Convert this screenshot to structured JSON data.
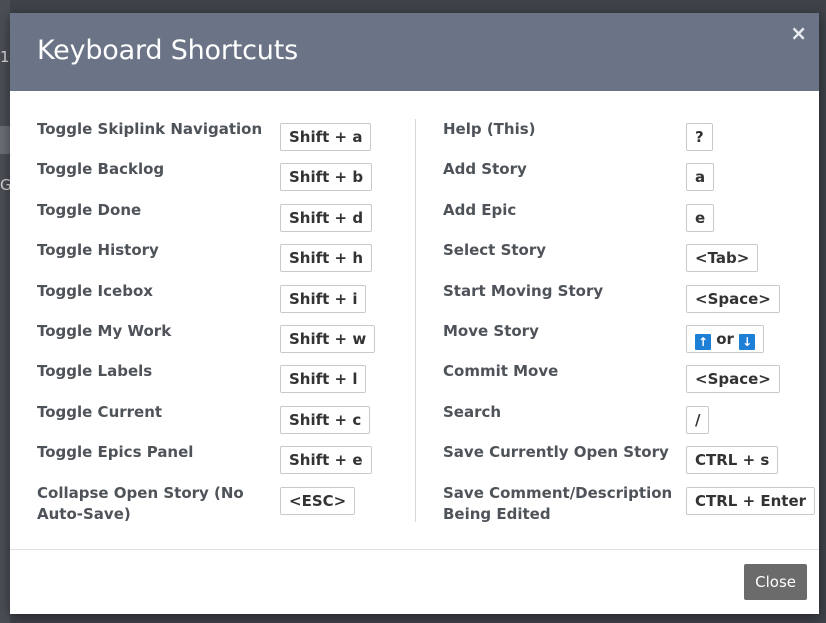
{
  "background": {
    "partial_text_1": "1",
    "partial_text_2": "G"
  },
  "modal": {
    "title": "Keyboard Shortcuts",
    "close_icon": "×",
    "close_button": "Close"
  },
  "shortcuts_left": [
    {
      "label": "Toggle Skiplink Navigation",
      "key": "Shift + a"
    },
    {
      "label": "Toggle Backlog",
      "key": "Shift + b"
    },
    {
      "label": "Toggle Done",
      "key": "Shift + d"
    },
    {
      "label": "Toggle History",
      "key": "Shift + h"
    },
    {
      "label": "Toggle Icebox",
      "key": "Shift + i"
    },
    {
      "label": "Toggle My Work",
      "key": "Shift + w"
    },
    {
      "label": "Toggle Labels",
      "key": "Shift + l"
    },
    {
      "label": "Toggle Current",
      "key": "Shift + c"
    },
    {
      "label": "Toggle Epics Panel",
      "key": "Shift + e"
    },
    {
      "label": "Collapse Open Story (No Auto-Save)",
      "key": "<ESC>"
    }
  ],
  "shortcuts_right": [
    {
      "label": "Help (This)",
      "key": "?"
    },
    {
      "label": "Add Story",
      "key": "a"
    },
    {
      "label": "Add Epic",
      "key": "e"
    },
    {
      "label": "Select Story",
      "key": "<Tab>"
    },
    {
      "label": "Start Moving Story",
      "key": "<Space>"
    },
    {
      "label": "Move Story",
      "key_up": "↑",
      "key_or": "or",
      "key_down": "↓"
    },
    {
      "label": "Commit Move",
      "key": "<Space>"
    },
    {
      "label": "Search",
      "key": "/"
    },
    {
      "label": "Save Currently Open Story",
      "key": "CTRL + s"
    },
    {
      "label": "Save Comment/Description Being Edited",
      "key": "CTRL + Enter"
    }
  ],
  "colors": {
    "header": "#6a7486",
    "overlay": "#3f4349",
    "arrow_key": "#1e7fd6",
    "close_button": "#6b6b6b"
  }
}
